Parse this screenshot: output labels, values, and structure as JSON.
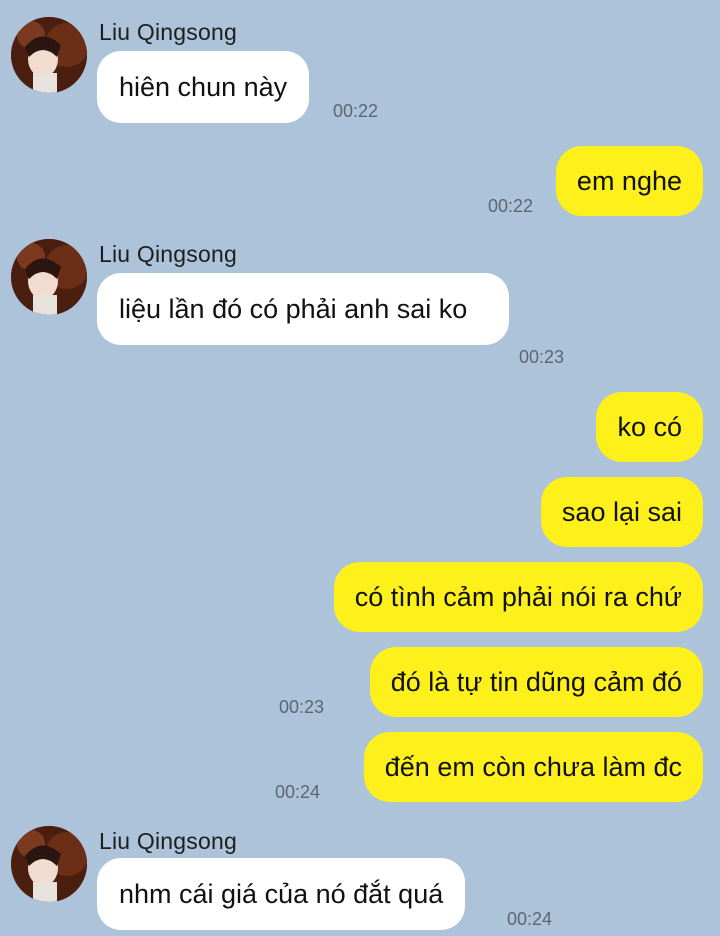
{
  "contact": {
    "name": "Liu Qingsong",
    "avatar_icon": "profile-avatar-icon"
  },
  "colors": {
    "background": "#adc3d9",
    "incoming_bubble": "#ffffff",
    "outgoing_bubble": "#fef01b"
  },
  "messages": [
    {
      "direction": "in",
      "sender": "Liu Qingsong",
      "text": "hiên chun này",
      "time": "00:22"
    },
    {
      "direction": "out",
      "text": "em nghe",
      "time": "00:22"
    },
    {
      "direction": "in",
      "sender": "Liu Qingsong",
      "text": "liệu lần đó có phải anh sai ko",
      "time": "00:23"
    },
    {
      "direction": "out",
      "text": "ko có"
    },
    {
      "direction": "out",
      "text": "sao lại sai"
    },
    {
      "direction": "out",
      "text": "có tình cảm phải nói ra chứ"
    },
    {
      "direction": "out",
      "text": "đó là tự tin dũng cảm đó",
      "time": "00:23"
    },
    {
      "direction": "out",
      "text": "đến em còn chưa làm đc",
      "time": "00:24"
    },
    {
      "direction": "in",
      "sender": "Liu Qingsong",
      "text": "nhm cái giá của nó đắt quá",
      "time": "00:24"
    }
  ]
}
